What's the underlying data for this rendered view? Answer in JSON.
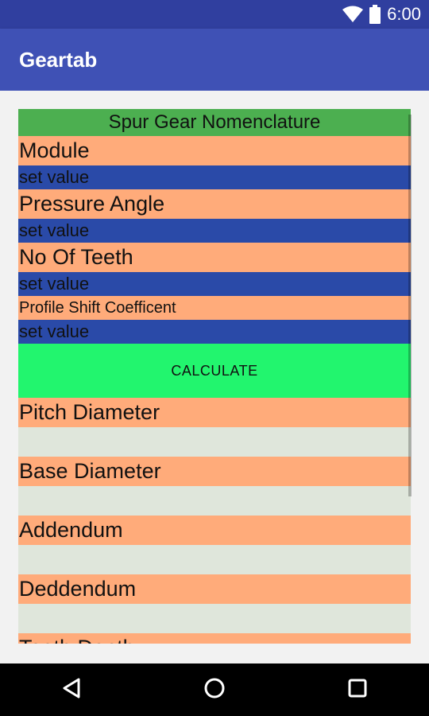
{
  "status_bar": {
    "time": "6:00",
    "icons": [
      "wifi-icon",
      "battery-icon"
    ]
  },
  "app_bar": {
    "title": "Geartab"
  },
  "form": {
    "header": "Spur Gear Nomenclature",
    "module_label": "Module",
    "module_input_placeholder": "set value",
    "pressure_angle_label": "Pressure Angle",
    "pressure_angle_input_placeholder": "set value",
    "teeth_label": "No Of Teeth",
    "teeth_input_placeholder": "set value",
    "profile_shift_label": "Profile Shift Coefficent",
    "profile_shift_input_placeholder": "set value",
    "calculate_button": "CALCULATE"
  },
  "results": {
    "pitch_diameter_label": "Pitch Diameter",
    "pitch_diameter_value": "",
    "base_diameter_label": "Base Diameter",
    "base_diameter_value": "",
    "addendum_label": "Addendum",
    "addendum_value": "",
    "deddendum_label": "Deddendum",
    "deddendum_value": "",
    "teeth_depth_label": "Teeth Depth"
  },
  "colors": {
    "status_bar": "#303f9f",
    "app_bar": "#3f51b5",
    "header_row": "#4caf50",
    "label_row": "#ffab7a",
    "input_row": "#2a4aa8",
    "calculate_button": "#22f56e",
    "result_row": "#dfe6db"
  },
  "nav_bar": {
    "buttons": [
      "back-icon",
      "home-icon",
      "recents-icon"
    ]
  }
}
